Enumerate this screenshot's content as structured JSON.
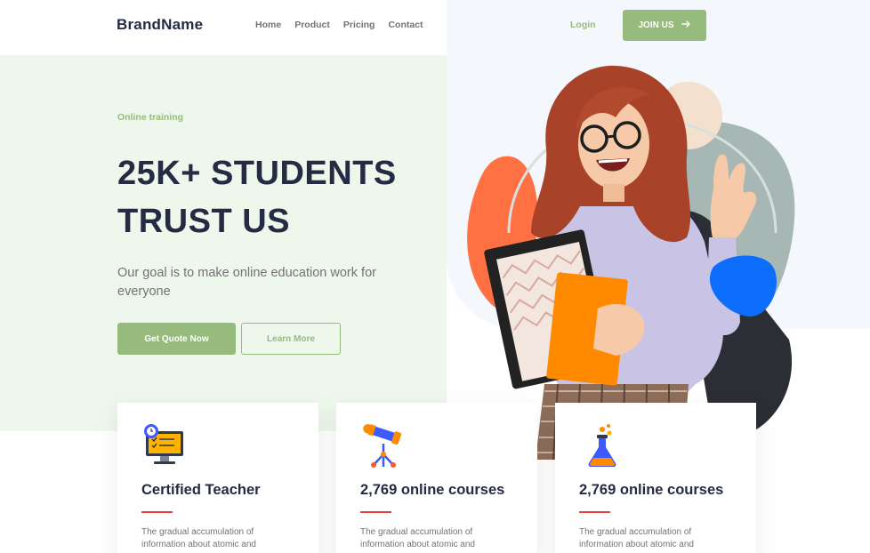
{
  "header": {
    "brand": "BrandName",
    "nav": [
      "Home",
      "Product",
      "Pricing",
      "Contact"
    ],
    "login_label": "Login",
    "join_label": "JOIN US",
    "join_icon": "arrow-right-icon"
  },
  "hero": {
    "eyebrow": "Online training",
    "headline_line1": "25K+ STUDENTS",
    "headline_line2": "TRUST US",
    "subtitle": "Our goal is to make online education work for everyone",
    "primary_button": "Get Quote Now",
    "secondary_button": "Learn More"
  },
  "features": [
    {
      "icon": "computer-checklist-icon",
      "title": "Certified Teacher",
      "text": "The gradual accumulation of information about atomic and"
    },
    {
      "icon": "telescope-icon",
      "title": "2,769 online courses",
      "text": "The gradual accumulation of information about atomic and"
    },
    {
      "icon": "flask-icon",
      "title": "2,769 online courses",
      "text": "The gradual accumulation of information about atomic and"
    }
  ],
  "colors": {
    "primary": "#96BB7C",
    "text_dark": "#252B42",
    "text_muted": "#737373",
    "accent_red": "#E74040",
    "hero_bg": "#EEF7EC"
  }
}
